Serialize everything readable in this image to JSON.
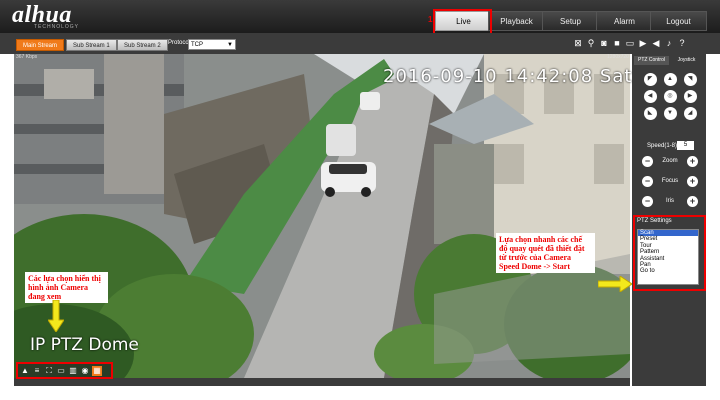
{
  "header": {
    "logo": "alhua",
    "logo_sub": "TECHNOLOGY",
    "nav": [
      {
        "label": "Live"
      },
      {
        "label": "Playback"
      },
      {
        "label": "Setup"
      },
      {
        "label": "Alarm"
      },
      {
        "label": "Logout"
      }
    ],
    "step_marker": "1"
  },
  "toolbar": {
    "streams": [
      {
        "label": "Main Stream"
      },
      {
        "label": "Sub Stream 1"
      },
      {
        "label": "Sub Stream 2"
      }
    ],
    "protocol_label": "Protocol",
    "protocol_value": "TCP"
  },
  "video": {
    "bitrate": "367 Kbps",
    "resolution": "1280x720",
    "timestamp": "2016-09-10 14:42:08 Sat",
    "camera_name": "IP PTZ Dome"
  },
  "annotations": {
    "left_note": "Các lựa chọn hiển thị hình ảnh Camera đang xem",
    "right_note": "Lựa chọn nhanh các chế độ quay quét đã thiết đặt từ trước của Camera Speed Dome -> Start"
  },
  "ptz": {
    "tabs": [
      {
        "label": "PTZ Control"
      },
      {
        "label": "Joystick"
      }
    ],
    "speed_label": "Speed(1-8):",
    "speed_value": "5",
    "zoom_label": "Zoom",
    "focus_label": "Focus",
    "iris_label": "Iris",
    "settings_title": "PTZ Settings",
    "settings_options": [
      "Scan",
      "Preset",
      "Tour",
      "Pattern",
      "Assistant",
      "Pan",
      "Go to"
    ]
  },
  "colors": {
    "accent": "#f07a1a",
    "highlight": "#e00000"
  }
}
